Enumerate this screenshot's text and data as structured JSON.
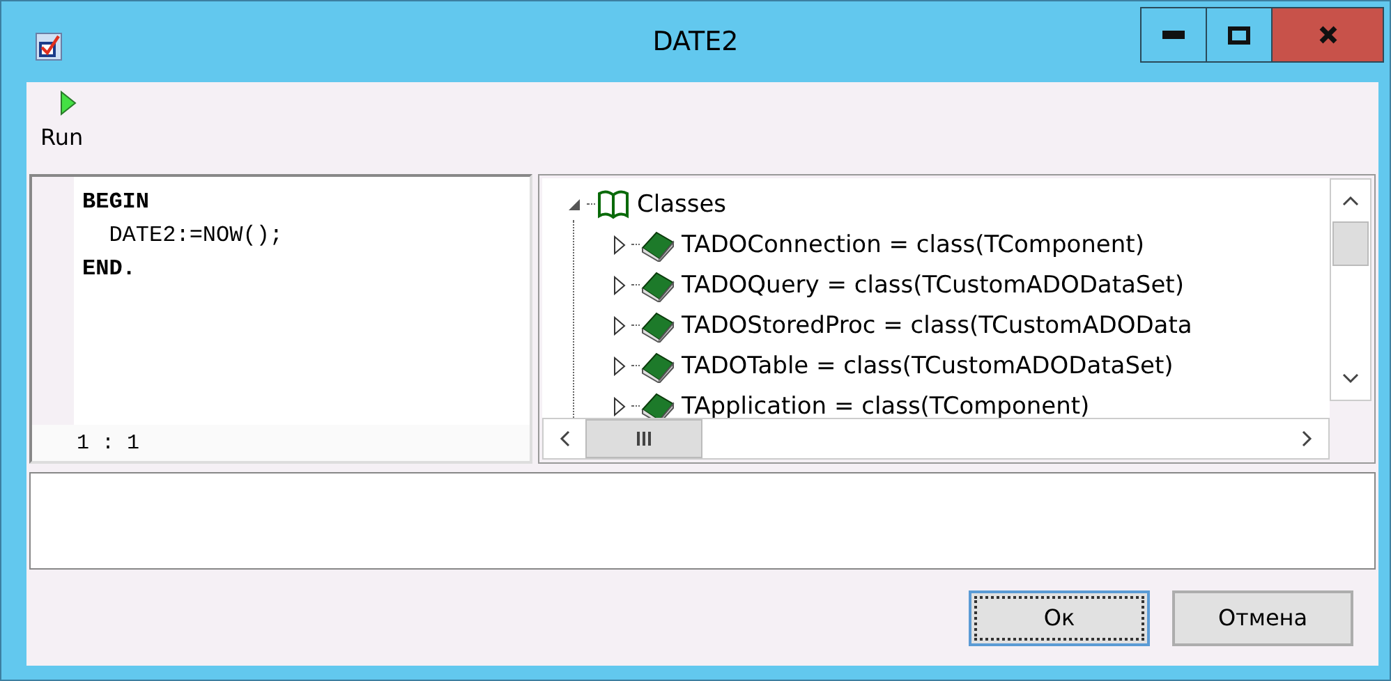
{
  "window": {
    "title": "DATE2"
  },
  "toolbar": {
    "buttons": [
      {
        "label": "Run"
      }
    ]
  },
  "editor": {
    "lines": [
      {
        "text": "BEGIN",
        "kind": "keyword"
      },
      {
        "text": "  DATE2:=NOW();",
        "kind": "statement"
      },
      {
        "text": "END.",
        "kind": "keyword"
      }
    ],
    "cursor_position": "1 : 1"
  },
  "tree": {
    "root": {
      "label": "Classes",
      "expanded": true,
      "children": [
        {
          "label": "TADOConnection = class(TComponent)",
          "expanded": false
        },
        {
          "label": "TADOQuery = class(TCustomADODataSet)",
          "expanded": false
        },
        {
          "label": "TADOStoredProc = class(TCustomADOData",
          "expanded": false
        },
        {
          "label": "TADOTable = class(TCustomADODataSet)",
          "expanded": false
        },
        {
          "label": "TApplication = class(TComponent)",
          "expanded": false
        }
      ]
    }
  },
  "buttons": [
    {
      "label": "Ок",
      "focused": true
    },
    {
      "label": "Отмена",
      "focused": false
    }
  ]
}
